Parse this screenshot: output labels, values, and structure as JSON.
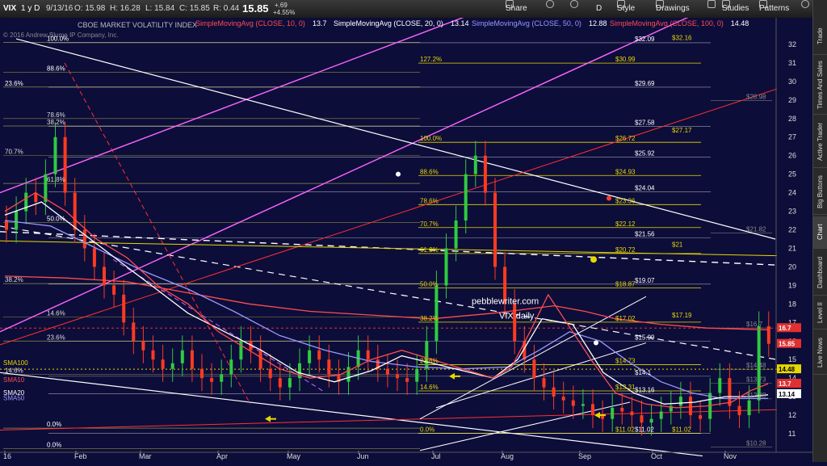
{
  "toolbar": {
    "symbol": "VIX",
    "period": "1 y D",
    "date": "9/13/16",
    "open": "O: 15.98",
    "high": "H: 16.28",
    "low": "L: 15.84",
    "close": "C: 15.85",
    "range": "R: 0.44",
    "last": "15.85",
    "change_abs": "+.69",
    "change_pct": "+4.55%",
    "share": "Share",
    "style": "Style",
    "drawings": "Drawings",
    "studies": "Studies",
    "patterns": "Patterns",
    "d_label": "D"
  },
  "sidebar": {
    "tabs": [
      "Trade",
      "Times And Sales",
      "Active Trader",
      "Big Buttons",
      "Chart",
      "Dashboard",
      "Level II",
      "Live News"
    ]
  },
  "chart_data": {
    "type": "line",
    "title_name": "CBOE MARKET VOLATILITY INDEX",
    "copyright": "© 2016 Andrew Blume IP Company, Inc.",
    "studies": [
      {
        "label": "SimpleMovingAvg (CLOSE, 10, 0)",
        "value": "13.7",
        "color": "#ff4d4d"
      },
      {
        "label": "SimpleMovingAvg (CLOSE, 20, 0)",
        "value": "13.14",
        "color": "#ffffff"
      },
      {
        "label": "SimpleMovingAvg (CLOSE, 50, 0)",
        "value": "12.88",
        "color": "#9999ff"
      },
      {
        "label": "SimpleMovingAvg (CLOSE, 100, 0)",
        "value": "14.48",
        "color": "#ff4d4d"
      }
    ],
    "watermark": [
      "pebblewriter.com",
      "VIX daily"
    ],
    "x_labels": [
      "16",
      "Feb",
      "Mar",
      "Apr",
      "May",
      "Jun",
      "Jul",
      "Aug",
      "Sep",
      "Oct",
      "Nov"
    ],
    "y_ticks": [
      11,
      12,
      13,
      14,
      15,
      16,
      17,
      18,
      19,
      20,
      21,
      22,
      23,
      24,
      25,
      26,
      27,
      28,
      29,
      30,
      31,
      32
    ],
    "ylim": [
      10,
      33
    ],
    "price_badges": [
      {
        "value": "16.7",
        "color": "#e03030"
      },
      {
        "value": "15.85",
        "color": "#e03030"
      },
      {
        "value": "14.48",
        "color": "#e6d800"
      },
      {
        "value": "13.7",
        "color": "#e03030"
      },
      {
        "value": "13.14",
        "color": "#ffffff"
      }
    ],
    "fib_left": [
      {
        "label": "100.0%",
        "y": 32.1
      },
      {
        "label": "88.6%",
        "y": 30.5
      },
      {
        "label": "23.6%",
        "y": 29.7
      },
      {
        "label": "78.6%",
        "y": 28.0
      },
      {
        "label": "38.2%",
        "y": 27.6
      },
      {
        "label": "70.7%",
        "y": 26.0
      },
      {
        "label": "61.8%",
        "y": 24.5
      },
      {
        "label": "50.0%",
        "y": 22.4
      },
      {
        "label": "38.2%",
        "y": 19.1
      },
      {
        "label": "14.6%",
        "y": 17.3
      },
      {
        "label": "23.6%",
        "y": 16.0
      },
      {
        "label": "14.6%",
        "y": 14.2
      },
      {
        "label": "0.0%",
        "y": 11.3
      },
      {
        "label": "0.0%",
        "y": 10.2
      }
    ],
    "fib_right": [
      {
        "label": "127.2%",
        "value": "$30.99",
        "y": 30.99
      },
      {
        "label": "100.0%",
        "value": "$26.72",
        "y": 26.72
      },
      {
        "label": "88.6%",
        "value": "$24.93",
        "y": 24.93
      },
      {
        "label": "78.6%",
        "value": "$23.36",
        "y": 23.36
      },
      {
        "label": "70.7%",
        "value": "$22.12",
        "y": 22.12
      },
      {
        "label": "61.8%",
        "value": "$20.72",
        "y": 20.72
      },
      {
        "label": "50.0%",
        "value": "$18.87",
        "y": 18.87
      },
      {
        "label": "38.2%",
        "value": "$17.02",
        "y": 17.02
      },
      {
        "label": "23.6%",
        "value": "$14.73",
        "y": 14.73
      },
      {
        "label": "14.6%",
        "value": "$13.31",
        "y": 13.31
      },
      {
        "label": "0.0%",
        "value": "$11.02",
        "y": 11.02
      }
    ],
    "levels_white": [
      {
        "value": "$32.09",
        "y": 32.09
      },
      {
        "value": "$29.69",
        "y": 29.69
      },
      {
        "value": "$27.58",
        "y": 27.58
      },
      {
        "value": "$25.92",
        "y": 25.92
      },
      {
        "value": "$24.04",
        "y": 24.04
      },
      {
        "value": "$21.56",
        "y": 21.56
      },
      {
        "value": "$19.07",
        "y": 19.07
      },
      {
        "value": "$15.99",
        "y": 15.99
      },
      {
        "value": "$14.1",
        "y": 14.1
      },
      {
        "value": "$13.16",
        "y": 13.16
      },
      {
        "value": "$11.02",
        "y": 11.02
      }
    ],
    "levels_yellow_right": [
      {
        "value": "$32.16",
        "y": 32.16
      },
      {
        "value": "$27.17",
        "y": 27.17
      },
      {
        "value": "$21",
        "y": 21.0
      },
      {
        "value": "$17.19",
        "y": 17.19
      },
      {
        "value": "$11.02",
        "y": 11.02
      }
    ],
    "levels_gray_right": [
      {
        "value": "$28.98",
        "y": 28.98
      },
      {
        "value": "$21.82",
        "y": 21.82
      },
      {
        "value": "$16.7",
        "y": 16.7
      },
      {
        "value": "$14.48",
        "y": 14.48
      },
      {
        "value": "$13.73",
        "y": 13.73
      },
      {
        "value": "$12.88",
        "y": 12.88
      },
      {
        "value": "$10.28",
        "y": 10.28
      }
    ],
    "ma_labels": [
      "SMA100",
      "SMA10",
      "SMA20",
      "SMA50"
    ],
    "series": [
      {
        "name": "SMA100",
        "color": "#ff4d4d",
        "x": [
          0,
          20,
          40,
          60,
          80,
          100,
          120,
          140,
          160,
          180,
          190,
          200,
          215,
          230,
          250
        ],
        "y": [
          19.5,
          19.4,
          19.2,
          18.6,
          18.0,
          17.6,
          17.4,
          17.2,
          17.5,
          17.9,
          17.6,
          17.2,
          16.9,
          16.7,
          16.6
        ]
      },
      {
        "name": "SMA50",
        "color": "#9999ff",
        "x": [
          0,
          15,
          30,
          45,
          60,
          75,
          90,
          105,
          120,
          135,
          150,
          165,
          175,
          185,
          195,
          205,
          215,
          225,
          235,
          250
        ],
        "y": [
          22.5,
          22.2,
          21.0,
          19.8,
          18.8,
          17.6,
          16.3,
          15.5,
          14.9,
          14.6,
          14.5,
          14.6,
          15.5,
          16.5,
          16.0,
          14.8,
          13.8,
          13.2,
          12.9,
          12.9
        ]
      },
      {
        "name": "SMA20",
        "color": "#ffffff",
        "x": [
          0,
          12,
          24,
          36,
          48,
          60,
          72,
          84,
          96,
          108,
          120,
          130,
          140,
          150,
          160,
          168,
          176,
          186,
          196,
          206,
          216,
          226,
          236,
          244,
          250
        ],
        "y": [
          22.8,
          23.5,
          22.0,
          20.5,
          19.0,
          17.5,
          16.5,
          15.5,
          14.3,
          13.8,
          14.4,
          15.2,
          14.8,
          14.4,
          14.0,
          15.0,
          17.2,
          16.9,
          14.3,
          13.2,
          12.6,
          12.7,
          13.0,
          13.0,
          13.1
        ]
      },
      {
        "name": "SMA10",
        "color": "#ff4d4d",
        "x": [
          0,
          10,
          20,
          30,
          40,
          50,
          60,
          70,
          80,
          90,
          100,
          110,
          120,
          130,
          140,
          150,
          160,
          166,
          172,
          178,
          184,
          192,
          200,
          210,
          220,
          230,
          238,
          244,
          250
        ],
        "y": [
          23,
          24,
          23,
          21.5,
          20.5,
          19,
          18,
          16.5,
          15.5,
          14.5,
          14,
          14.2,
          15,
          15.5,
          15,
          14.5,
          14,
          14.6,
          16.5,
          18.5,
          17,
          15,
          13.2,
          12.6,
          12.4,
          12.5,
          12.7,
          13.3,
          13.7
        ]
      }
    ]
  }
}
